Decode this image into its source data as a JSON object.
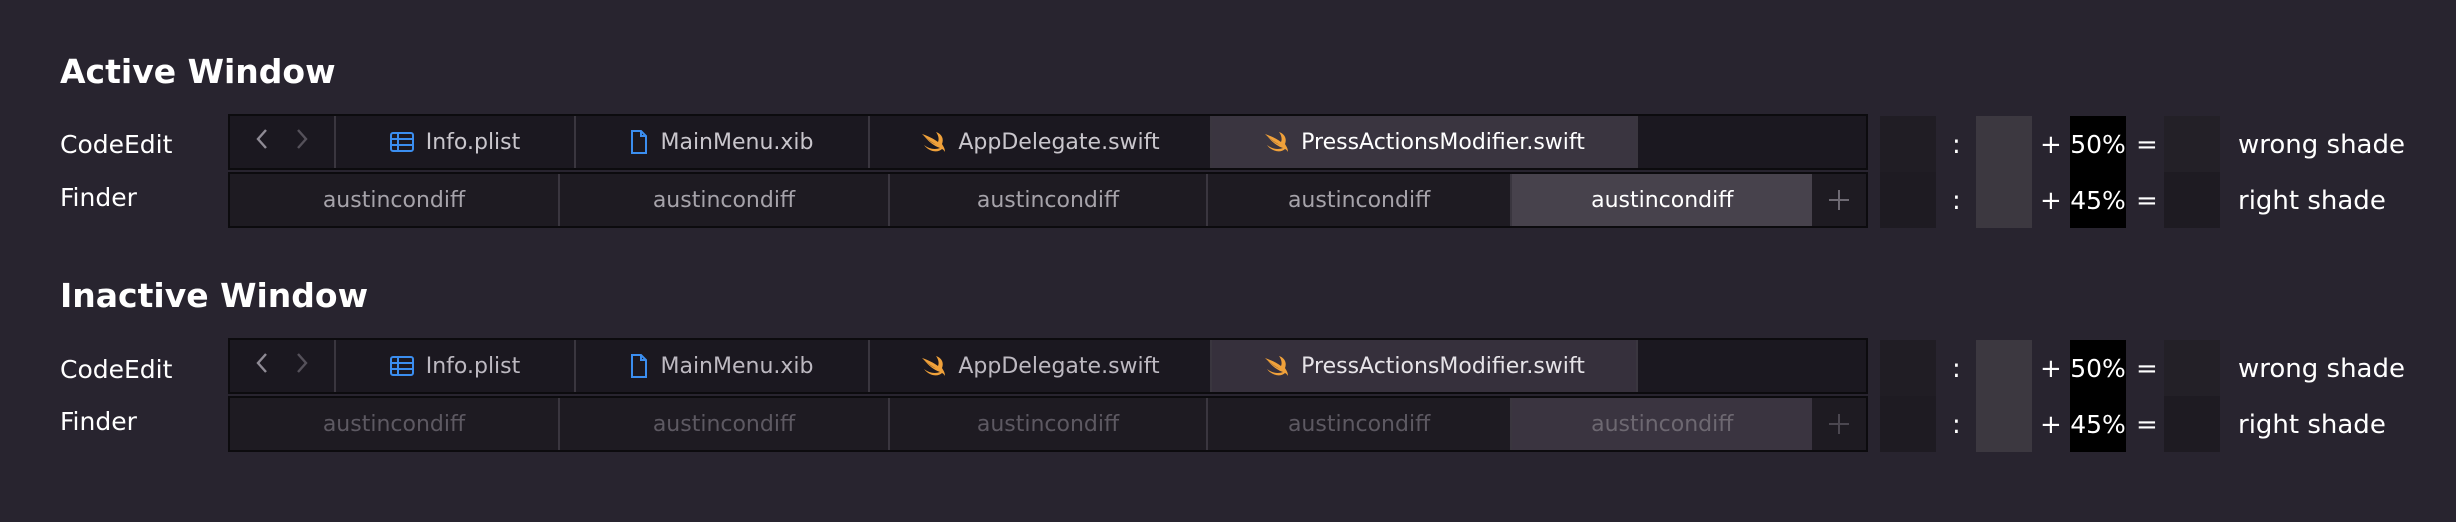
{
  "sections": [
    {
      "title": "Active Window",
      "codeedit_label": "CodeEdit",
      "finder_label": "Finder",
      "tabs": [
        "Info.plist",
        "MainMenu.xib",
        "AppDelegate.swift",
        "PressActionsModifier.swift"
      ],
      "finder_tabs": [
        "austincondiff",
        "austincondiff",
        "austincondiff",
        "austincondiff",
        "austincondiff"
      ],
      "formula_rows": [
        {
          "colon": ":",
          "plus": "+",
          "percent": "50%",
          "equals": "=",
          "label": "wrong shade"
        },
        {
          "colon": ":",
          "plus": "+",
          "percent": "45%",
          "equals": "=",
          "label": "right shade"
        }
      ]
    },
    {
      "title": "Inactive Window",
      "codeedit_label": "CodeEdit",
      "finder_label": "Finder",
      "tabs": [
        "Info.plist",
        "MainMenu.xib",
        "AppDelegate.swift",
        "PressActionsModifier.swift"
      ],
      "finder_tabs": [
        "austincondiff",
        "austincondiff",
        "austincondiff",
        "austincondiff",
        "austincondiff"
      ],
      "formula_rows": [
        {
          "colon": ":",
          "plus": "+",
          "percent": "50%",
          "equals": "=",
          "label": "wrong shade"
        },
        {
          "colon": ":",
          "plus": "+",
          "percent": "45%",
          "equals": "=",
          "label": "right shade"
        }
      ]
    }
  ],
  "icons": {
    "back": "chevron-left-icon",
    "forward": "chevron-right-icon",
    "plist": "table-icon",
    "xib": "document-icon",
    "swift": "swift-icon",
    "new_tab": "plus-icon"
  },
  "colors": {
    "background": "#28242f",
    "swift_orange": "#f0a13a",
    "file_blue": "#3b8ef0",
    "swatch_dark": "#201d24",
    "swatch_mid": "#3c3840",
    "swatch_result_wrong": "#232027",
    "swatch_result_right": "#1e1b22"
  }
}
